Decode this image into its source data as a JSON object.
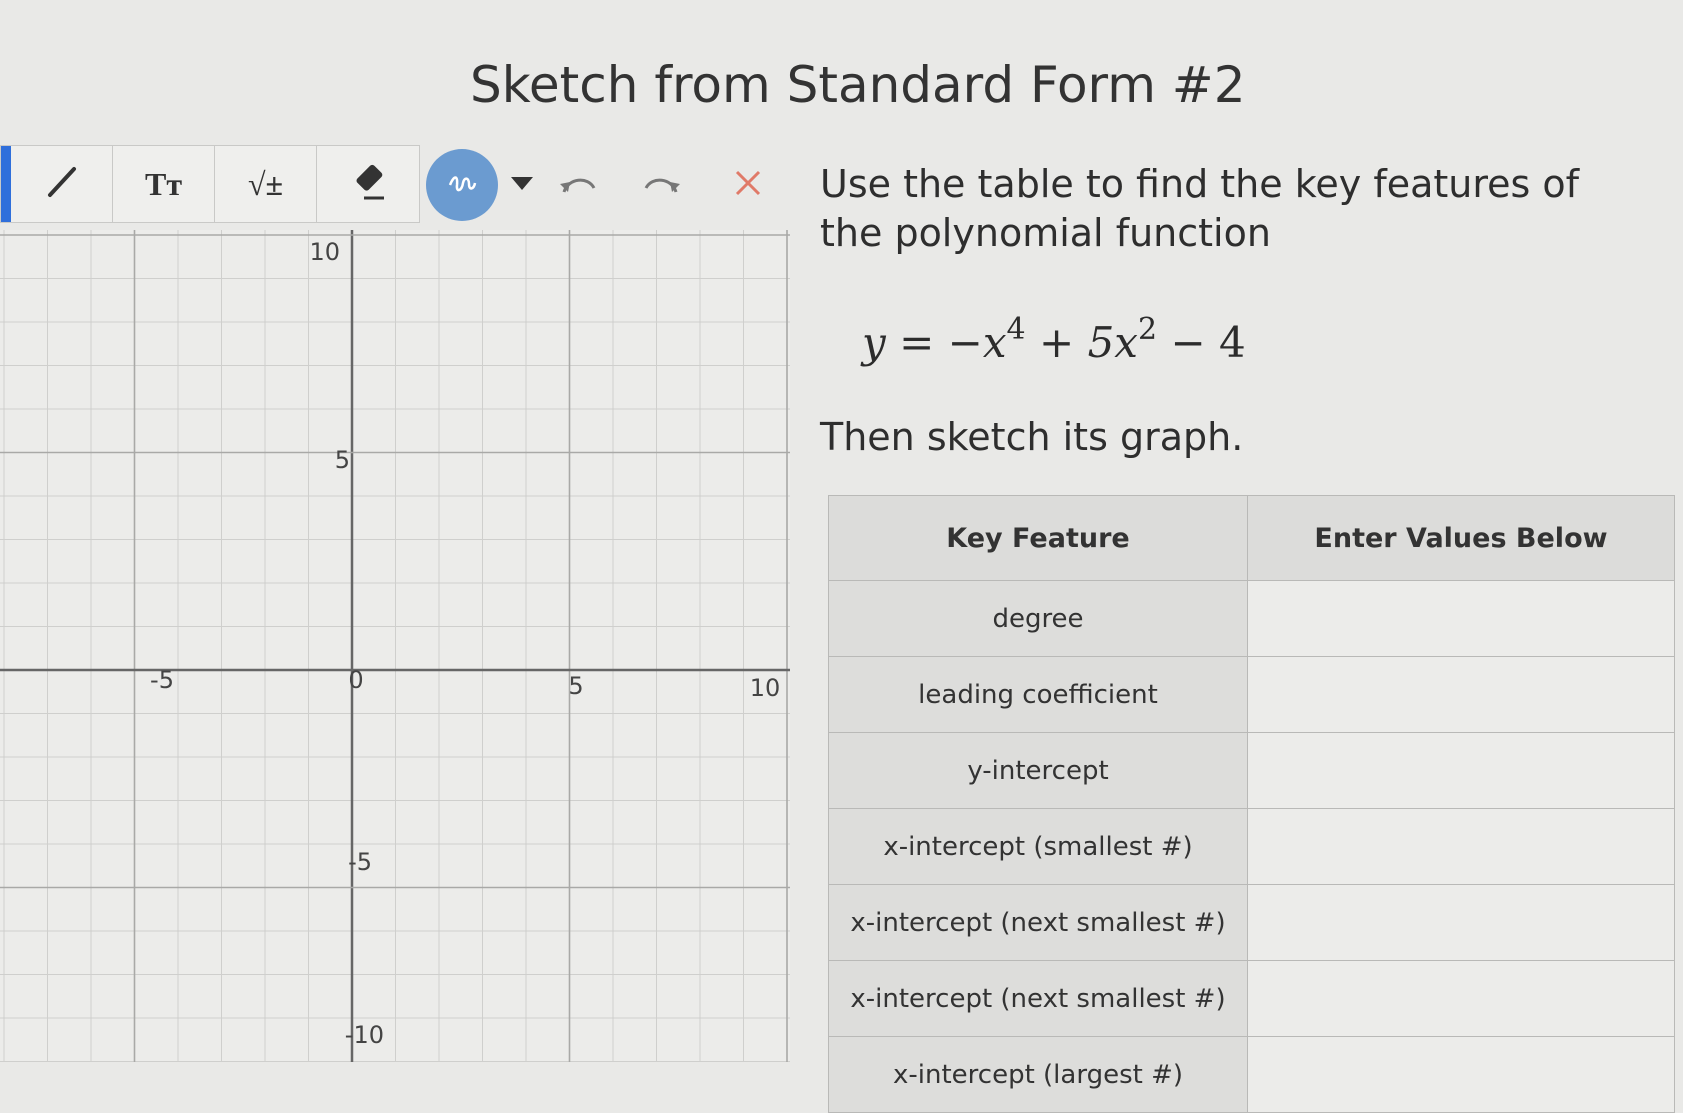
{
  "page": {
    "title": "Sketch from Standard Form #2",
    "prompt": "Use the table to find the key features of the polynomial function",
    "instruction": "Then sketch its graph."
  },
  "toolbar": {
    "tools": [
      {
        "name": "line-tool",
        "icon": "pencil-line-icon",
        "label": ""
      },
      {
        "name": "text-tool",
        "icon": "text-size-icon",
        "label": "Tт"
      },
      {
        "name": "math-tool",
        "icon": "square-root-icon",
        "label": "√±"
      },
      {
        "name": "eraser-tool",
        "icon": "eraser-icon",
        "label": ""
      }
    ],
    "color_button": {
      "icon": "scribble-icon",
      "color": "#6b9bd0"
    },
    "dropdown_icon": "caret-down-icon",
    "undo_icon": "undo-icon",
    "redo_icon": "redo-icon",
    "clear_icon": "close-icon",
    "accent_color": "#2f6fdb",
    "clear_color": "#e07a68"
  },
  "graph": {
    "x_tick_labels": [
      "-5",
      "0",
      "5",
      "10"
    ],
    "y_tick_labels": [
      "10",
      "5",
      "-5",
      "-10"
    ],
    "x_range": [
      -10,
      10
    ],
    "y_range": [
      -10,
      10
    ],
    "grid": true
  },
  "formula": {
    "lhs": "y",
    "equals": "=",
    "term1": "−x",
    "exp1": "4",
    "op1": "+",
    "term2": "5x",
    "exp2": "2",
    "op2": "−",
    "constant": "4"
  },
  "table": {
    "headers": [
      "Key Feature",
      "Enter Values Below"
    ],
    "rows": [
      {
        "feature": "degree",
        "value": ""
      },
      {
        "feature": "leading coefficient",
        "value": ""
      },
      {
        "feature": "y-intercept",
        "value": ""
      },
      {
        "feature": "x-intercept (smallest #)",
        "value": ""
      },
      {
        "feature": "x-intercept (next smallest #)",
        "value": ""
      },
      {
        "feature": "x-intercept (next smallest #)",
        "value": ""
      },
      {
        "feature": "x-intercept (largest #)",
        "value": ""
      }
    ]
  }
}
